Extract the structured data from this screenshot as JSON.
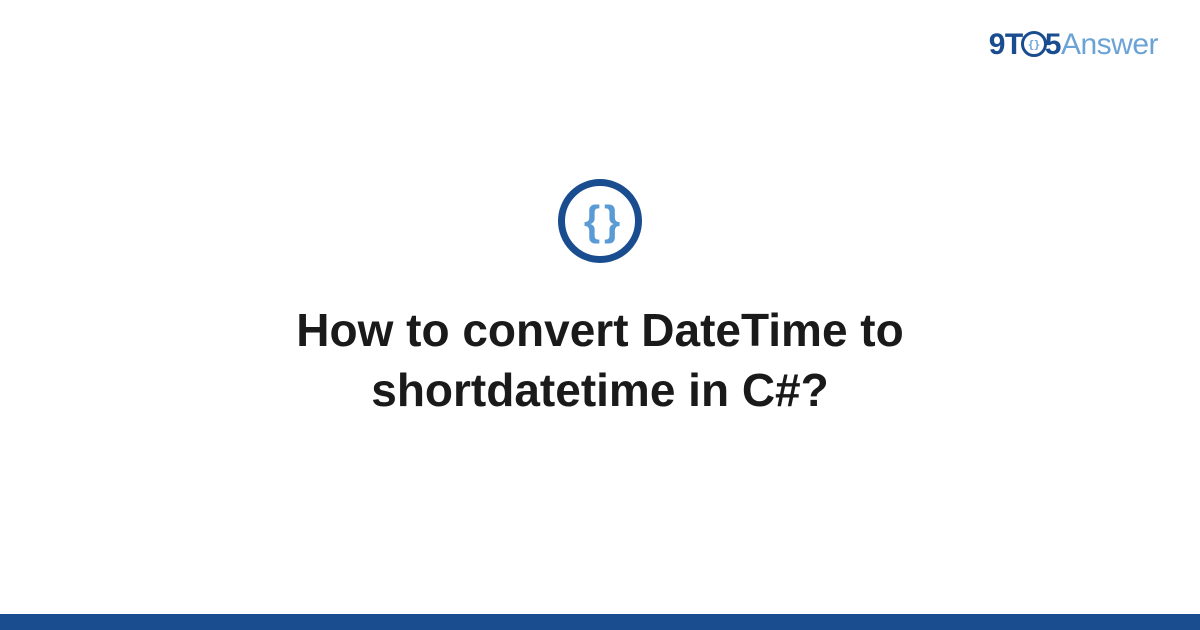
{
  "logo": {
    "part1": "9T",
    "part_o_inner": "{}",
    "part2": "5",
    "part3": "Answer"
  },
  "icon": {
    "glyph": "{ }",
    "name": "code-braces-icon"
  },
  "title": "How to convert DateTime to shortdatetime in C#?",
  "colors": {
    "primary": "#1a4d8f",
    "accent": "#6ba3d6"
  }
}
